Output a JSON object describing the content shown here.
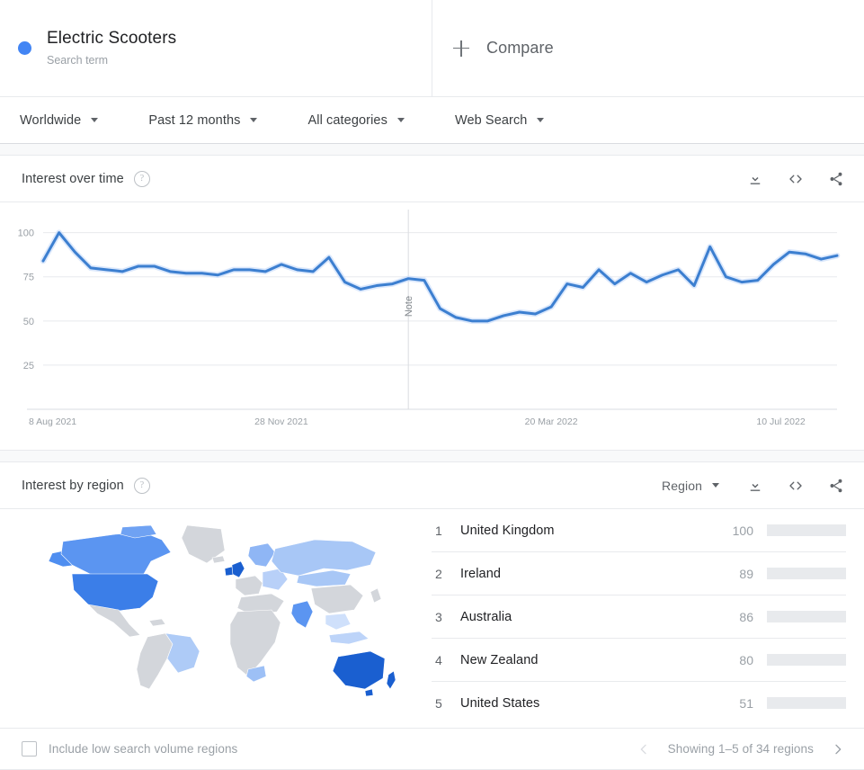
{
  "term": {
    "title": "Electric Scooters",
    "subtitle": "Search term",
    "dot_color": "#4285f4"
  },
  "compare": {
    "label": "Compare",
    "icon": "plus-icon"
  },
  "filters": [
    {
      "label": "Worldwide",
      "icon": "chevron-down-icon"
    },
    {
      "label": "Past 12 months",
      "icon": "chevron-down-icon"
    },
    {
      "label": "All categories",
      "icon": "chevron-down-icon"
    },
    {
      "label": "Web Search",
      "icon": "chevron-down-icon"
    }
  ],
  "interest_over_time": {
    "title": "Interest over time",
    "help_icon": "help-circle-icon",
    "actions": [
      {
        "name": "download-icon"
      },
      {
        "name": "embed-code-icon"
      },
      {
        "name": "share-icon"
      }
    ]
  },
  "interest_by_region": {
    "title": "Interest by region",
    "help_icon": "help-circle-icon",
    "select": {
      "label": "Region",
      "icon": "chevron-down-icon"
    },
    "actions": [
      {
        "name": "download-icon"
      },
      {
        "name": "embed-code-icon"
      },
      {
        "name": "share-icon"
      }
    ],
    "rows": [
      {
        "rank": "1",
        "name": "United Kingdom",
        "value": "100",
        "pct": 100
      },
      {
        "rank": "2",
        "name": "Ireland",
        "value": "89",
        "pct": 89
      },
      {
        "rank": "3",
        "name": "Australia",
        "value": "86",
        "pct": 86
      },
      {
        "rank": "4",
        "name": "New Zealand",
        "value": "80",
        "pct": 80
      },
      {
        "rank": "5",
        "name": "United States",
        "value": "51",
        "pct": 51
      }
    ],
    "footer": {
      "checkbox_label": "Include low search volume regions",
      "checked": false,
      "pager_text": "Showing 1–5 of 34 regions",
      "prev_icon": "chevron-left-icon",
      "next_icon": "chevron-right-icon"
    },
    "map": {
      "bar_color": "#4285f4",
      "track_color": "#e8eaed",
      "no_data_color": "#d3d6db"
    }
  },
  "chart_data": {
    "type": "line",
    "title": "Interest over time",
    "xlabel": "",
    "ylabel": "",
    "ylim": [
      0,
      110
    ],
    "yticks": [
      25,
      50,
      75,
      100
    ],
    "ytick_labels": [
      "25",
      "50",
      "75",
      "100"
    ],
    "grid": true,
    "line_color": "#4285f4",
    "series_name": "Electric Scooters",
    "xtick_labels": [
      "8 Aug 2021",
      "28 Nov 2021",
      "20 Mar 2022",
      "10 Jul 2022"
    ],
    "xtick_positions": [
      0,
      15,
      32,
      48
    ],
    "annotation": {
      "label": "Note",
      "x_index": 23
    },
    "x": [
      "8 Aug 2021",
      "15 Aug 2021",
      "22 Aug 2021",
      "29 Aug 2021",
      "5 Sep 2021",
      "12 Sep 2021",
      "19 Sep 2021",
      "26 Sep 2021",
      "3 Oct 2021",
      "10 Oct 2021",
      "17 Oct 2021",
      "24 Oct 2021",
      "31 Oct 2021",
      "7 Nov 2021",
      "14 Nov 2021",
      "28 Nov 2021",
      "5 Dec 2021",
      "12 Dec 2021",
      "19 Dec 2021",
      "26 Dec 2021",
      "2 Jan 2022",
      "9 Jan 2022",
      "16 Jan 2022",
      "23 Jan 2022",
      "30 Jan 2022",
      "6 Feb 2022",
      "13 Feb 2022",
      "20 Feb 2022",
      "27 Feb 2022",
      "6 Mar 2022",
      "13 Mar 2022",
      "20 Mar 2022",
      "27 Mar 2022",
      "3 Apr 2022",
      "10 Apr 2022",
      "17 Apr 2022",
      "24 Apr 2022",
      "1 May 2022",
      "8 May 2022",
      "15 May 2022",
      "22 May 2022",
      "29 May 2022",
      "5 Jun 2022",
      "12 Jun 2022",
      "19 Jun 2022",
      "26 Jun 2022",
      "3 Jul 2022",
      "10 Jul 2022",
      "17 Jul 2022",
      "24 Jul 2022",
      "31 Jul 2022"
    ],
    "values": [
      84,
      100,
      89,
      80,
      79,
      78,
      81,
      81,
      78,
      77,
      77,
      76,
      79,
      79,
      78,
      82,
      79,
      78,
      86,
      72,
      68,
      70,
      71,
      74,
      73,
      57,
      52,
      50,
      50,
      53,
      55,
      54,
      58,
      71,
      69,
      79,
      71,
      77,
      72,
      76,
      79,
      70,
      92,
      75,
      72,
      73,
      82,
      89,
      88,
      85,
      87
    ]
  }
}
